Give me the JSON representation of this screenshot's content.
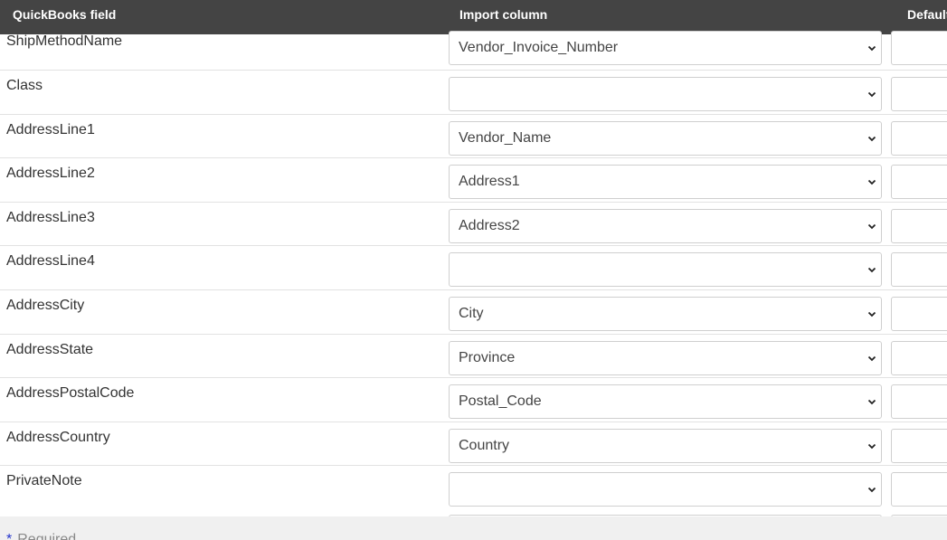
{
  "table": {
    "headers": {
      "field": "QuickBooks field",
      "import": "Import column",
      "default": "Default"
    },
    "rows": [
      {
        "field": "ShipMethodName",
        "import": "Vendor_Invoice_Number",
        "default": ""
      },
      {
        "field": "Class",
        "import": "",
        "default": ""
      },
      {
        "field": "AddressLine1",
        "import": "Vendor_Name",
        "default": ""
      },
      {
        "field": "AddressLine2",
        "import": "Address1",
        "default": ""
      },
      {
        "field": "AddressLine3",
        "import": "Address2",
        "default": ""
      },
      {
        "field": "AddressLine4",
        "import": "",
        "default": ""
      },
      {
        "field": "AddressCity",
        "import": "City",
        "default": ""
      },
      {
        "field": "AddressState",
        "import": "Province",
        "default": ""
      },
      {
        "field": "AddressPostalCode",
        "import": "Postal_Code",
        "default": ""
      },
      {
        "field": "AddressCountry",
        "import": "Country",
        "default": ""
      },
      {
        "field": "PrivateNote",
        "import": "",
        "default": ""
      }
    ]
  },
  "footer": {
    "required_star": "*",
    "required_label": "Required"
  },
  "icons": {
    "dropdown": "chevron-down-icon"
  },
  "colors": {
    "header_bg": "#444444",
    "header_text": "#ffffff",
    "required_star": "#2233cc"
  }
}
